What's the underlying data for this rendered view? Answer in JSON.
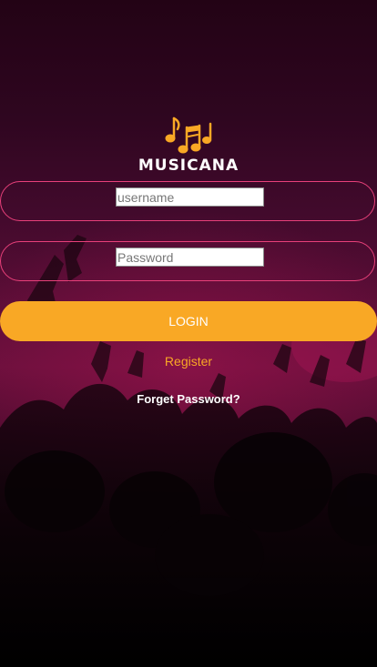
{
  "app": {
    "name": "MUSICANA"
  },
  "login_form": {
    "username_placeholder": "username",
    "password_placeholder": "Password",
    "login_label": "LOGIN",
    "register_label": "Register",
    "forget_password_label": "Forget Password?"
  },
  "icons": {
    "logo": "music-notes-icon"
  },
  "colors": {
    "accent": "#f9a825",
    "field_border": "#e8407a",
    "background_top": "#230315",
    "background_mid": "#6a0f3c",
    "background_bottom": "#000000"
  }
}
